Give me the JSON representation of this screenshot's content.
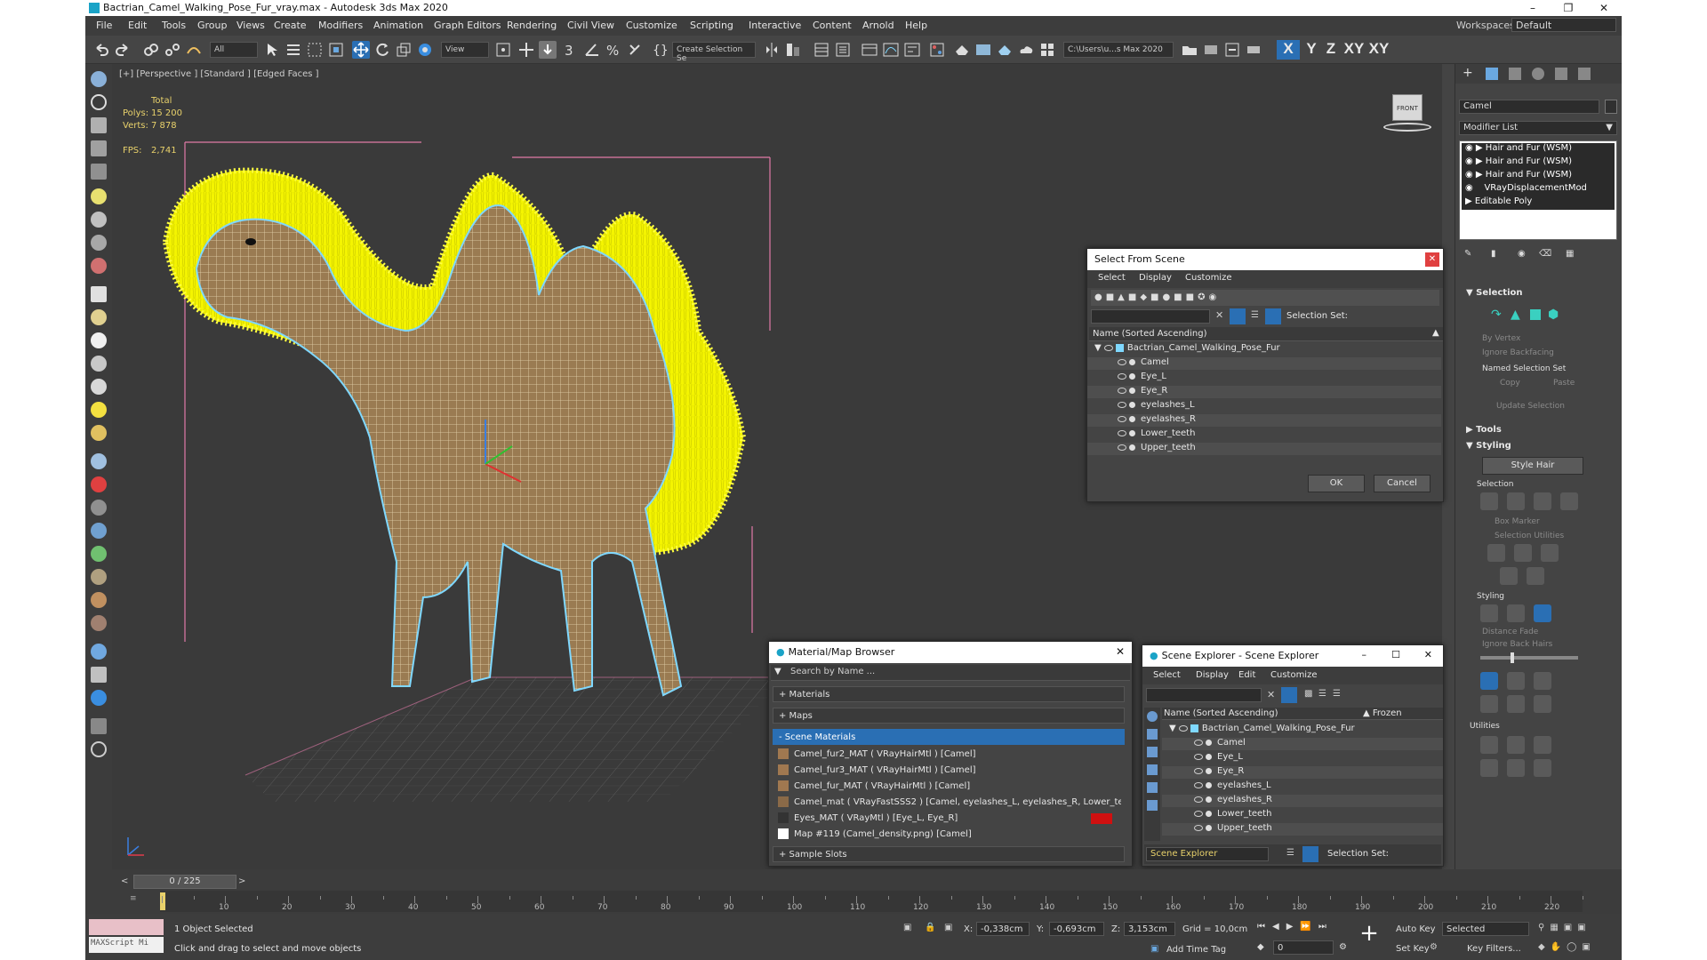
{
  "window": {
    "title": "Bactrian_Camel_Walking_Pose_Fur_vray.max - Autodesk 3ds Max 2020",
    "workspaces_label": "Workspaces:",
    "workspace_value": "Default"
  },
  "menu": [
    "File",
    "Edit",
    "Tools",
    "Group",
    "Views",
    "Create",
    "Modifiers",
    "Animation",
    "Graph Editors",
    "Rendering",
    "Civil View",
    "Customize",
    "Scripting",
    "Interactive",
    "Content",
    "Arnold",
    "Help"
  ],
  "toolbar": {
    "filter_value": "All",
    "ref_coord_value": "View",
    "selection_set_placeholder": "Create Selection Se",
    "project_path": "C:\\Users\\u...s Max 2020",
    "axis_labels": [
      "X",
      "Y",
      "Z",
      "XY",
      "XY"
    ]
  },
  "viewport": {
    "label": "[+] [Perspective ] [Standard ] [Edged Faces ]",
    "stats": {
      "total_label": "Total",
      "polys_label": "Polys:",
      "polys_value": "15 200",
      "verts_label": "Verts:",
      "verts_value": "7 878",
      "fps_label": "FPS:",
      "fps_value": "2,741"
    },
    "viewcube_label": "FRONT"
  },
  "select_from_scene": {
    "title": "Select From Scene",
    "menu": [
      "Select",
      "Display",
      "Customize"
    ],
    "selection_set_label": "Selection Set:",
    "column_header": "Name (Sorted Ascending)",
    "root": "Bactrian_Camel_Walking_Pose_Fur",
    "items": [
      "Camel",
      "Eye_L",
      "Eye_R",
      "eyelashes_L",
      "eyelashes_R",
      "Lower_teeth",
      "Upper_teeth"
    ],
    "ok_label": "OK",
    "cancel_label": "Cancel"
  },
  "material_browser": {
    "title": "Material/Map Browser",
    "search_placeholder": "Search by Name ...",
    "sections": [
      "+ Materials",
      "+ Maps",
      "- Scene Materials"
    ],
    "items": [
      "Camel_fur2_MAT  ( VRayHairMtl )  [Camel]",
      "Camel_fur3_MAT  ( VRayHairMtl )  [Camel]",
      "Camel_fur_MAT  ( VRayHairMtl )  [Camel]",
      "Camel_mat  ( VRayFastSSS2 )  [Camel, eyelashes_L, eyelashes_R, Lower_te...",
      "Eyes_MAT  ( VRayMtl )  [Eye_L, Eye_R]",
      "Map #119 (Camel_density.png)  [Camel]"
    ],
    "footer_section": "+ Sample Slots"
  },
  "scene_explorer": {
    "title": "Scene Explorer - Scene Explorer",
    "menu": [
      "Select",
      "Display",
      "Edit",
      "Customize"
    ],
    "column_header": "Name (Sorted Ascending)",
    "frozen_header": "▲ Frozen",
    "root": "Bactrian_Camel_Walking_Pose_Fur",
    "items": [
      "Camel",
      "Eye_L",
      "Eye_R",
      "eyelashes_L",
      "eyelashes_R",
      "Lower_teeth",
      "Upper_teeth"
    ],
    "explorer_dropdown": "Scene Explorer",
    "selection_set_label": "Selection Set:"
  },
  "command_panel": {
    "object_name": "Camel",
    "modifier_list_label": "Modifier List",
    "modifier_stack": [
      "Hair and Fur (WSM)",
      "Hair and Fur (WSM)",
      "Hair and Fur (WSM)",
      "VRayDisplacementMod",
      "Editable Poly"
    ],
    "selection_rollout": "Selection",
    "by_vertex": "By Vertex",
    "ignore_backfacing": "Ignore Backfacing",
    "named_selection_set": "Named Selection Set",
    "copy_label": "Copy",
    "paste_label": "Paste",
    "update_selection": "Update Selection",
    "tools_rollout": "Tools",
    "styling_rollout": "Styling",
    "style_hair_label": "Style Hair",
    "selection_group": "Selection",
    "box_marker": "Box Marker",
    "selection_utilities": "Selection Utilities",
    "styling_group": "Styling",
    "distance_fade": "Distance Fade",
    "ignore_back_hairs": "Ignore Back Hairs",
    "utilities_group": "Utilities"
  },
  "timeline": {
    "frame_display": "0 / 225",
    "ticks": [
      "10",
      "20",
      "30",
      "40",
      "50",
      "60",
      "70",
      "80",
      "90",
      "100",
      "110",
      "120",
      "130",
      "140",
      "150",
      "160",
      "170",
      "180",
      "190",
      "200",
      "210",
      "220"
    ]
  },
  "statusbar": {
    "maxscript_label": "MAXScript Mi",
    "status_text": "1 Object Selected",
    "prompt_text": "Click and drag to select and move objects",
    "x_label": "X:",
    "x_value": "-0,338cm",
    "y_label": "Y:",
    "y_value": "-0,693cm",
    "z_label": "Z:",
    "z_value": "3,153cm",
    "grid_label": "Grid = 10,0cm",
    "add_time_tag": "Add Time Tag",
    "auto_key": "Auto Key",
    "selected_dropdown": "Selected",
    "set_key": "Set Key",
    "key_filters": "Key Filters...",
    "frame_value": "0"
  },
  "colors": {
    "fur_yellow": "#f4f400",
    "wire_cyan": "#7fd8ff",
    "select_blue": "#2a6fb4"
  }
}
